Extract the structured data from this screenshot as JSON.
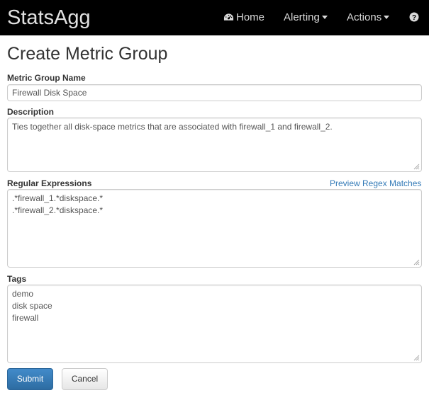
{
  "navbar": {
    "brand": "StatsAgg",
    "home_label": "Home",
    "alerting_label": "Alerting",
    "actions_label": "Actions",
    "help_icon": "question-circle-icon",
    "home_icon": "dashboard-icon"
  },
  "page": {
    "title": "Create Metric Group"
  },
  "form": {
    "name_label": "Metric Group Name",
    "name_value": "Firewall Disk Space",
    "description_label": "Description",
    "description_value": "Ties together all disk-space metrics that are associated with firewall_1 and firewall_2.",
    "regex_label": "Regular Expressions",
    "preview_link": "Preview Regex Matches",
    "regex_lines": [
      ".*firewall_1.*diskspace.*",
      ".*firewall_2.*diskspace.*"
    ],
    "tags_label": "Tags",
    "tags_lines": [
      "demo",
      "disk space",
      "firewall"
    ],
    "submit_label": "Submit",
    "cancel_label": "Cancel"
  },
  "colors": {
    "navbar_bg": "#000000",
    "link": "#337ab7",
    "primary_button": "#428bca"
  }
}
